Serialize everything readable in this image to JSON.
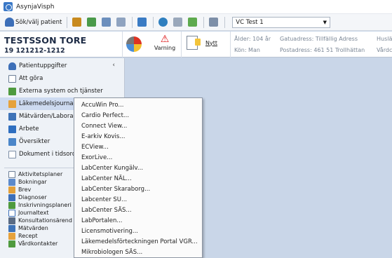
{
  "window": {
    "title": "AsynjaVisph"
  },
  "toolbar": {
    "search_patient_label": "Sök/välj patient",
    "unit_value": "VC Test 1"
  },
  "patient": {
    "name": "TESTSSON TORE",
    "personnummer": "19 121212-1212",
    "warning_label": "Varning",
    "new_label": "Nytt",
    "age": "Ålder: 104 år",
    "gender": "Kön: Man",
    "street": "Gatuadress: Tillfällig Adress",
    "postal": "Postadress: 461 51 Trollhättan",
    "extra1": "Huslä",
    "extra2": "Vårdc"
  },
  "sidebar": {
    "items": [
      {
        "label": "Patientuppgifter"
      },
      {
        "label": "Att göra"
      },
      {
        "label": "Externa system och tjänster"
      },
      {
        "label": "Läkemedelsjournal"
      },
      {
        "label": "Mätvärden/Labora"
      },
      {
        "label": "Arbete"
      },
      {
        "label": "Översikter"
      },
      {
        "label": "Dokument i tidsord"
      }
    ],
    "subitems": [
      {
        "label": "Aktivitetsplaner"
      },
      {
        "label": "Bokningar"
      },
      {
        "label": "Brev"
      },
      {
        "label": "Diagnoser"
      },
      {
        "label": "Inskrivningsplaneri"
      },
      {
        "label": "Journaltext"
      },
      {
        "label": "Konsultationsärend"
      },
      {
        "label": "Mätvärden"
      },
      {
        "label": "Recept"
      },
      {
        "label": "Vårdkontakter"
      }
    ]
  },
  "menu": {
    "items": [
      {
        "label": "AccuWin Pro..."
      },
      {
        "label": "Cardio Perfect..."
      },
      {
        "label": "Connect View..."
      },
      {
        "label": "E-arkiv Kovis..."
      },
      {
        "label": "ECView..."
      },
      {
        "label": "ExorLive..."
      },
      {
        "label": "LabCenter Kungälv..."
      },
      {
        "label": "LabCenter NÄL..."
      },
      {
        "label": "LabCenter Skaraborg..."
      },
      {
        "label": "Labcenter SU..."
      },
      {
        "label": "LabCenter SÄS..."
      },
      {
        "label": "LabPortalen..."
      },
      {
        "label": "Licensmotivering..."
      },
      {
        "label": "Läkemedelsförteckningen Portal VGR..."
      },
      {
        "label": "Mikrobiologen SÄS..."
      }
    ]
  },
  "colors": {
    "content_bg": "#c9d6e8",
    "sidebar_bg": "#eef2f7",
    "accent": "#3b79c7",
    "warning": "#dd1111"
  }
}
